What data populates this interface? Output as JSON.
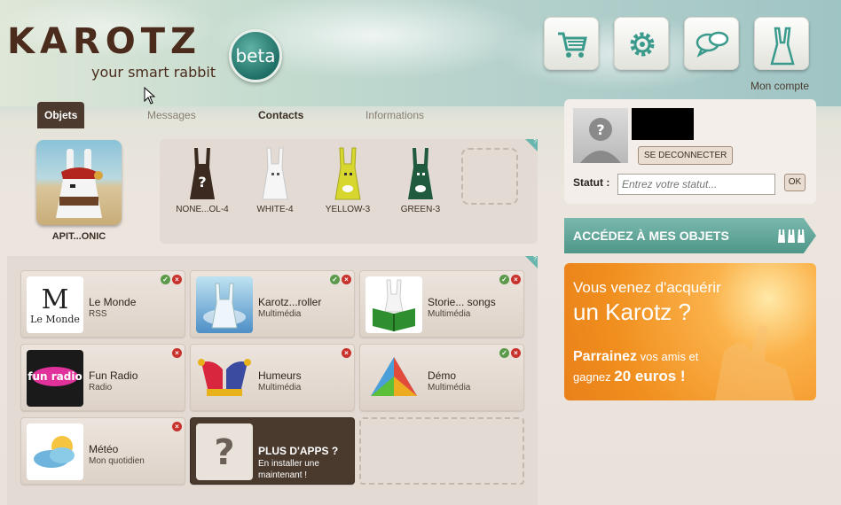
{
  "header": {
    "logo": "KAROTZ",
    "tagline": "your smart rabbit",
    "badge": "beta",
    "account_label": "Mon compte",
    "buttons": [
      {
        "name": "cart-icon"
      },
      {
        "name": "gear-icon"
      },
      {
        "name": "chat-icon"
      },
      {
        "name": "rabbit-icon"
      }
    ]
  },
  "tabs": [
    "Objets",
    "Messages",
    "Contacts",
    "Informations"
  ],
  "main_object": {
    "label": "APIT...ONIC"
  },
  "rabbits": [
    {
      "label": "NONE...OL-4",
      "color": "#3b2a20"
    },
    {
      "label": "WHITE-4",
      "color": "#f4f4f4"
    },
    {
      "label": "YELLOW-3",
      "color": "#d7d730"
    },
    {
      "label": "GREEN-3",
      "color": "#1f5b3c"
    }
  ],
  "apps": [
    {
      "name": "Le Monde",
      "sub": "RSS"
    },
    {
      "name": "Karotz...roller",
      "sub": "Multimédia"
    },
    {
      "name": "Storie... songs",
      "sub": "Multimédia"
    },
    {
      "name": "Fun Radio",
      "sub": "Radio"
    },
    {
      "name": "Humeurs",
      "sub": "Multimédia"
    },
    {
      "name": "Démo",
      "sub": "Multimédia"
    },
    {
      "name": "Météo",
      "sub": "Mon quotidien"
    },
    {
      "name": "PLUS D'APPS ?",
      "sub": "En installer une maintenant !"
    }
  ],
  "app_icons": {
    "lemonde": "M\nLe Monde",
    "funradio": "fun radio"
  },
  "profile": {
    "logout": "SE DECONNECTER",
    "statut_label": "Statut :",
    "statut_placeholder": "Entrez votre statut...",
    "ok": "OK"
  },
  "acces": "ACCÉDEZ À MES OBJETS",
  "promo": {
    "line1": "Vous venez d'acquérir",
    "line2": "un Karotz ?",
    "parrainez": "Parrainez",
    "line3_rest": " vos amis et",
    "line4_pre": "gagnez ",
    "amount": "20 euros !"
  },
  "colors": {
    "brand_brown": "#4a2b1c",
    "accent_teal": "#4e9788",
    "promo_orange": "#f08e1e"
  }
}
